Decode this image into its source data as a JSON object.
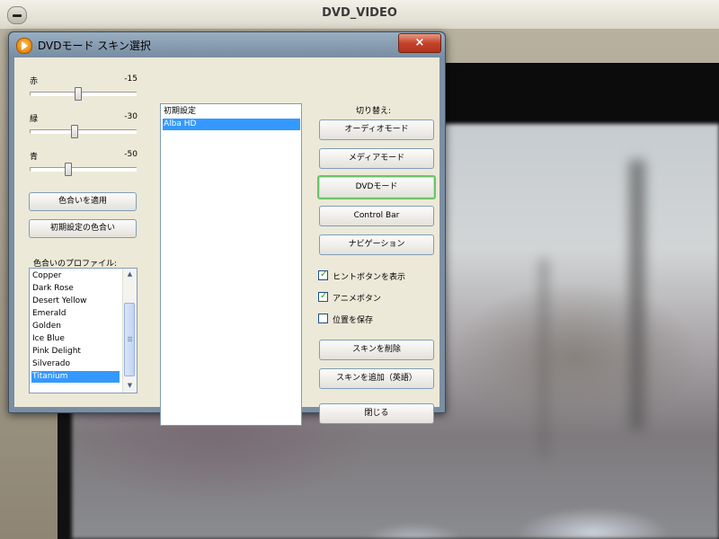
{
  "app": {
    "title": "DVD_VIDEO"
  },
  "dialog": {
    "title": "DVDモード スキン選択",
    "close_label": "×",
    "sliders": [
      {
        "label": "赤",
        "value": "-15"
      },
      {
        "label": "緑",
        "value": "-30"
      },
      {
        "label": "青",
        "value": "-50"
      }
    ],
    "apply_button": "色合いを適用",
    "default_color_button": "初期設定の色合い",
    "profile_label": "色合いのプロファイル:",
    "profiles": [
      "Copper",
      "Dark Rose",
      "Desert Yellow",
      "Emerald",
      "Golden",
      "Ice Blue",
      "Pink Delight",
      "Silverado",
      "Titanium"
    ],
    "profiles_selected": "Titanium",
    "skins": [
      "初期設定",
      "Alba HD"
    ],
    "skins_selected": "Alba HD",
    "switch_label": "切り替え:",
    "mode_buttons": [
      "オーディオモード",
      "メディアモード",
      "DVDモード",
      "Control Bar",
      "ナビゲーション"
    ],
    "active_mode": "DVDモード",
    "checkboxes": [
      {
        "label": "ヒントボタンを表示",
        "checked": true
      },
      {
        "label": "アニメボタン",
        "checked": true
      },
      {
        "label": "位置を保存",
        "checked": false
      }
    ],
    "delete_skin_button": "スキンを削除",
    "add_skin_button": "スキンを追加（英語）",
    "close_button": "閉じる"
  },
  "colors": {
    "selection": "#3399ff",
    "default_button_border": "#69c46b",
    "dialog_frame": "#7a8ea3"
  }
}
